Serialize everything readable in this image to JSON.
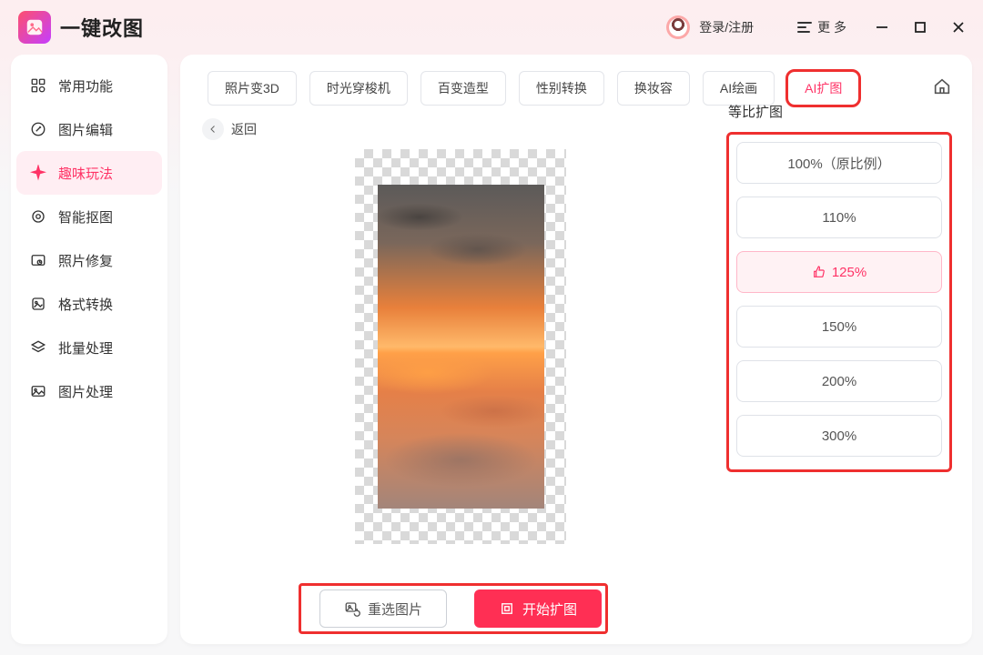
{
  "app": {
    "name": "一键改图"
  },
  "header": {
    "login_text": "登录/注册",
    "more_text": "更 多"
  },
  "sidebar": {
    "items": [
      {
        "label": "常用功能"
      },
      {
        "label": "图片编辑"
      },
      {
        "label": "趣味玩法"
      },
      {
        "label": "智能抠图"
      },
      {
        "label": "照片修复"
      },
      {
        "label": "格式转换"
      },
      {
        "label": "批量处理"
      },
      {
        "label": "图片处理"
      }
    ],
    "active_index": 2
  },
  "tabs": {
    "items": [
      "照片变3D",
      "时光穿梭机",
      "百变造型",
      "性别转换",
      "换妆容",
      "AI绘画",
      "AI扩图"
    ],
    "active_index": 6
  },
  "back_label": "返回",
  "scale": {
    "title": "等比扩图",
    "options": [
      "100%（原比例）",
      "110%",
      "125%",
      "150%",
      "200%",
      "300%"
    ],
    "recommended_index": 2,
    "active_index": 2
  },
  "actions": {
    "reselect": "重选图片",
    "start": "开始扩图"
  }
}
